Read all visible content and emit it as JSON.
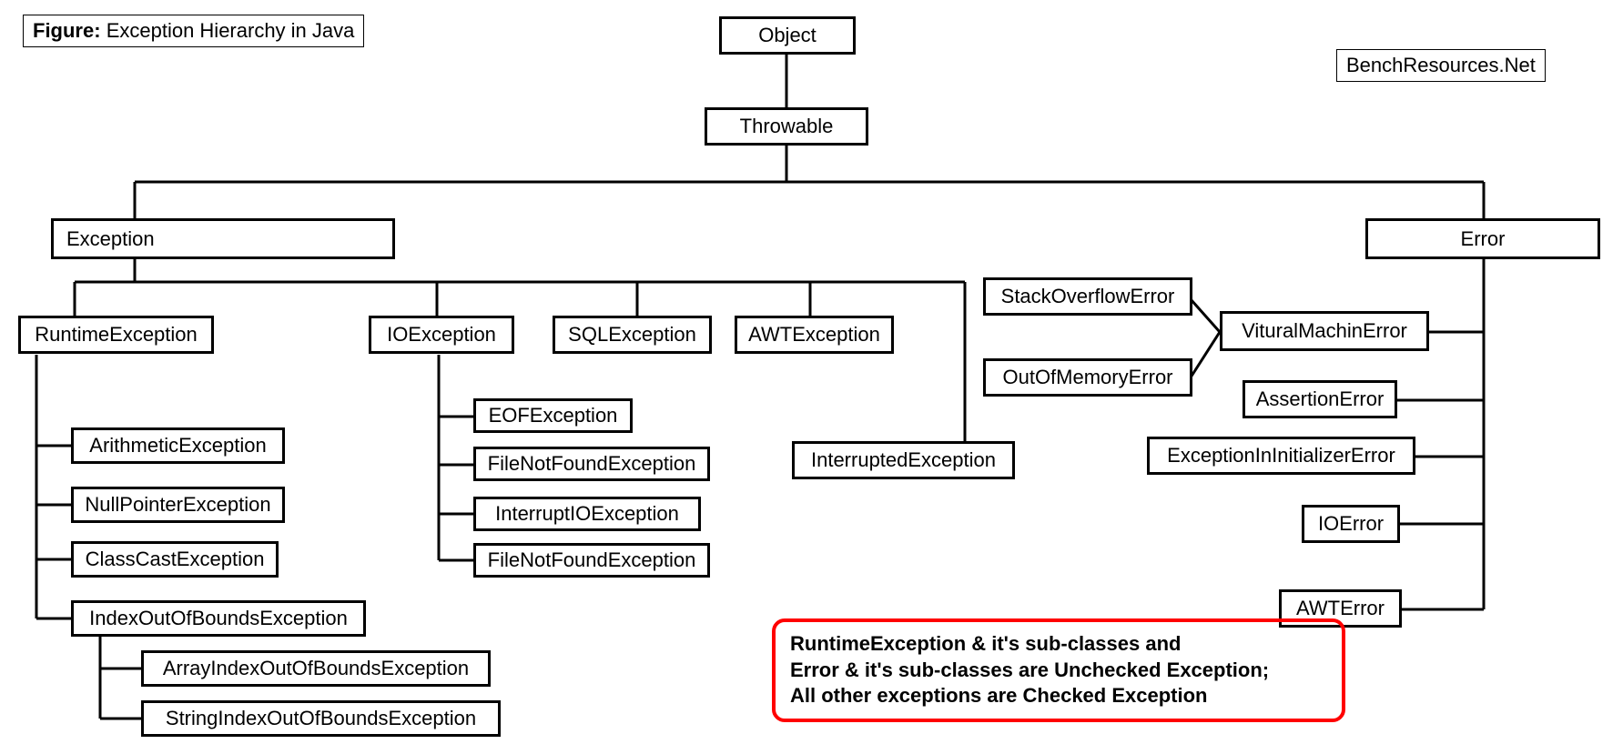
{
  "figure_label": "Figure:",
  "figure_title": "Exception Hierarchy in Java",
  "brand": "BenchResources.Net",
  "nodes": {
    "object": "Object",
    "throwable": "Throwable",
    "exception": "Exception",
    "error": "Error",
    "runtime": "RuntimeException",
    "io": "IOException",
    "sql": "SQLException",
    "awt": "AWTException",
    "interrupted": "InterruptedException",
    "arith": "ArithmeticException",
    "npe": "NullPointerException",
    "cce": "ClassCastException",
    "ioobe": "IndexOutOfBoundsException",
    "aioobe": "ArrayIndexOutOfBoundsException",
    "sioobe": "StringIndexOutOfBoundsException",
    "eof": "EOFException",
    "fnf1": "FileNotFoundException",
    "iioe": "InterruptIOException",
    "fnf2": "FileNotFoundException",
    "soe": "StackOverflowError",
    "oom": "OutOfMemoryError",
    "vme": "VituralMachinError",
    "asserterr": "AssertionError",
    "eiie": "ExceptionInInitializerError",
    "ioerror": "IOError",
    "awterror": "AWTError"
  },
  "note_l1": "RuntimeException & it's sub-classes and",
  "note_l2": "Error & it's sub-classes are Unchecked Exception;",
  "note_l3": "All other exceptions are Checked Exception"
}
